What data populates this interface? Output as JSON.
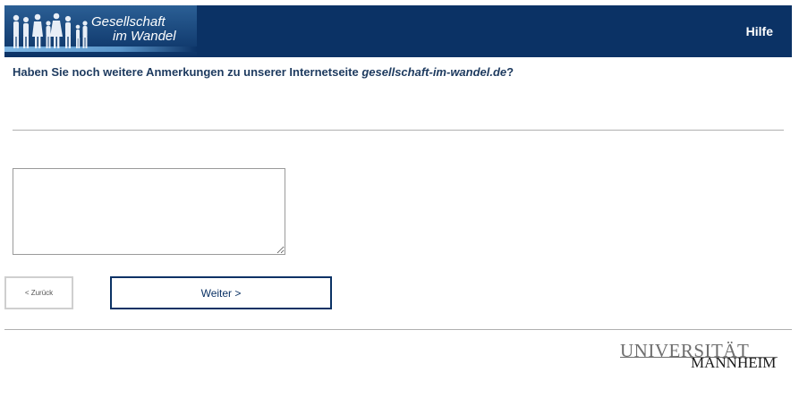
{
  "header": {
    "logo_line1": "Gesellschaft",
    "logo_line2": "im Wandel",
    "help_label": "Hilfe",
    "background_color": "#0b3265"
  },
  "question": {
    "text_before": "Haben Sie noch weitere Anmerkungen zu unserer Internetseite ",
    "site_name": "gesellschaft-im-wandel.de",
    "text_after": "?"
  },
  "comment": {
    "value": "",
    "placeholder": ""
  },
  "navigation": {
    "back_label": "< Zurück",
    "next_label": "Weiter >"
  },
  "footer": {
    "university_line1": "UNIVERSITÄT",
    "university_line2": "MANNHEIM"
  }
}
